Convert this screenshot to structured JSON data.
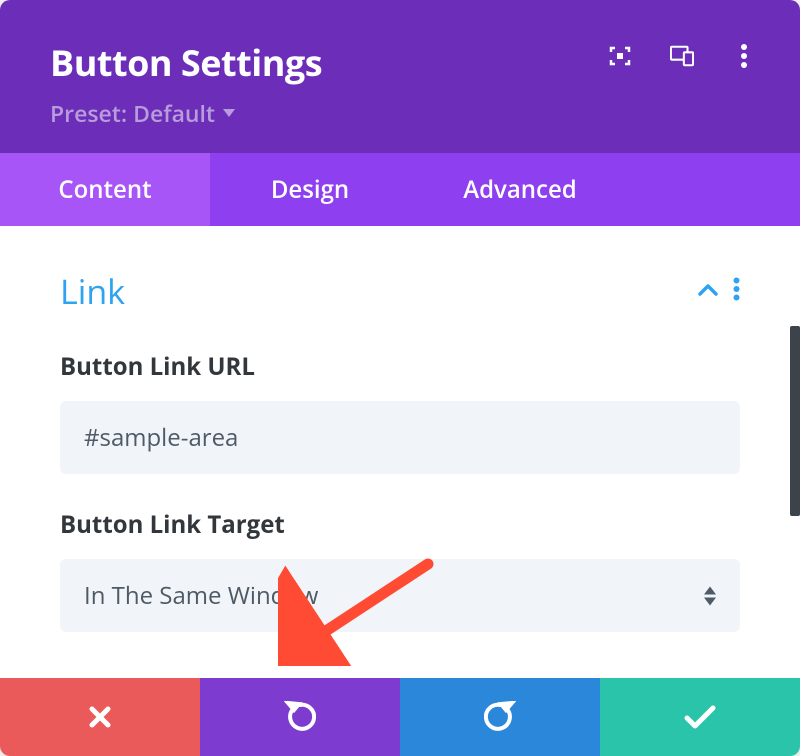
{
  "header": {
    "title": "Button Settings",
    "preset_label": "Preset: Default"
  },
  "tabs": {
    "content": "Content",
    "design": "Design",
    "advanced": "Advanced"
  },
  "section": {
    "title": "Link"
  },
  "fields": {
    "url_label": "Button Link URL",
    "url_value": "#sample-area",
    "target_label": "Button Link Target",
    "target_value": "In The Same Window"
  },
  "colors": {
    "header_bg": "#6c2eb9",
    "tab_bg": "#8e3ff0",
    "tab_active_bg": "#a855f7",
    "accent_blue": "#2ea3f2",
    "cancel": "#eb5a5a",
    "undo": "#7e3bd0",
    "redo": "#2b87da",
    "save": "#29c4a9"
  }
}
